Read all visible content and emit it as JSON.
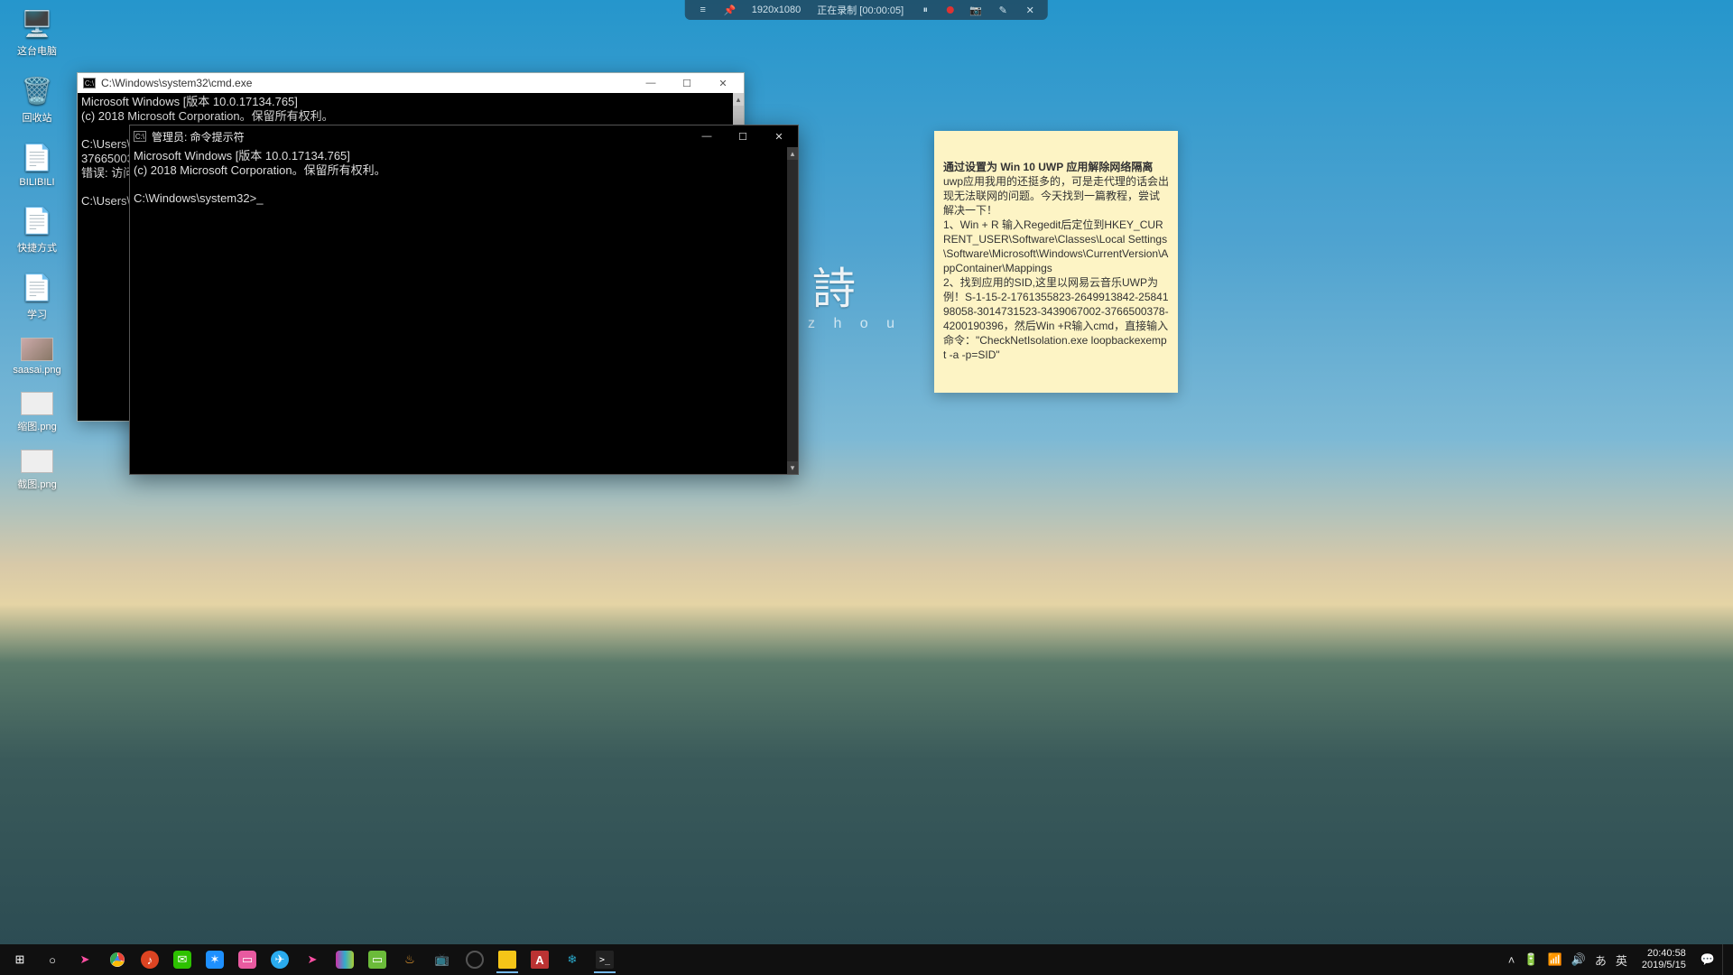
{
  "rec_bar": {
    "resolution": "1920x1080",
    "status": "正在录制 [00:00:05]"
  },
  "desktop_icons": [
    {
      "label": "这台电脑",
      "glyph": "🖥️"
    },
    {
      "label": "回收站",
      "glyph": "🗑️"
    },
    {
      "label": "BILIBILI",
      "glyph": "📄"
    },
    {
      "label": "快捷方式",
      "glyph": "📄"
    },
    {
      "label": "学习",
      "glyph": "📄"
    },
    {
      "label": "saasai.png",
      "glyph": "photo"
    },
    {
      "label": "缩图.png",
      "glyph": "thumb"
    },
    {
      "label": "截图.png",
      "glyph": "thumb"
    }
  ],
  "cmd_back": {
    "title": "C:\\Windows\\system32\\cmd.exe",
    "lines": [
      "Microsoft Windows [版本 10.0.17134.765]",
      "(c) 2018 Microsoft Corporation。保留所有权利。",
      "",
      "C:\\Users\\Z",
      "3766500378",
      "错误: 访问",
      "",
      "C:\\Users\\Z"
    ]
  },
  "cmd_admin": {
    "title": "管理员: 命令提示符",
    "lines": [
      "Microsoft Windows [版本 10.0.17134.765]",
      "(c) 2018 Microsoft Corporation。保留所有权利。",
      "",
      "C:\\Windows\\system32>"
    ]
  },
  "note": {
    "title": "通过设置为 Win 10 UWP 应用解除网络隔离",
    "body": "uwp应用我用的还挺多的，可是走代理的话会出现无法联网的问题。今天找到一篇教程，尝试解决一下！\n1、Win + R 输入Regedit后定位到HKEY_CURRENT_USER\\Software\\Classes\\Local Settings\\Software\\Microsoft\\Windows\\CurrentVersion\\AppContainer\\Mappings\n2、找到应用的SID,这里以网易云音乐UWP为例！S-1-15-2-1761355823-2649913842-2584198058-3014731523-3439067002-3766500378-4200190396，然后Win +R输入cmd，直接输入命令：\"CheckNetIsolation.exe loopbackexempt -a -p=SID\""
  },
  "poem": {
    "main": "詩",
    "sub": "z h o u"
  },
  "taskbar": {
    "items": [
      {
        "name": "start",
        "color": "#000",
        "glyph": "⊞"
      },
      {
        "name": "cortana",
        "color": "#000",
        "glyph": "○"
      },
      {
        "name": "cursor-app",
        "color": "#ff4fa3",
        "glyph": "➤"
      },
      {
        "name": "chrome",
        "color": "#fff",
        "glyph": "◉"
      },
      {
        "name": "netease-music",
        "color": "#d42",
        "glyph": "♪"
      },
      {
        "name": "wechat",
        "color": "#2dc100",
        "glyph": "✉"
      },
      {
        "name": "spark",
        "color": "#1e90ff",
        "glyph": "✶"
      },
      {
        "name": "app-pink",
        "color": "#e85aa0",
        "glyph": "▭"
      },
      {
        "name": "telegram",
        "color": "#2aa",
        "glyph": "✈"
      },
      {
        "name": "cursor-app-2",
        "color": "#ff4fa3",
        "glyph": "➤"
      },
      {
        "name": "app-stripes",
        "color": "#8833aa",
        "glyph": "≡"
      },
      {
        "name": "file-explorer",
        "color": "#6bbb3a",
        "glyph": "▭"
      },
      {
        "name": "app-flame",
        "color": "#f0a030",
        "glyph": "♨"
      },
      {
        "name": "app-tv",
        "color": "#222",
        "glyph": "📺"
      },
      {
        "name": "obs",
        "color": "#111",
        "glyph": "●"
      },
      {
        "name": "sticky-notes",
        "color": "#f5c518",
        "glyph": "▭",
        "active": true
      },
      {
        "name": "autodesk",
        "color": "#b33",
        "glyph": "A"
      },
      {
        "name": "app-teal",
        "color": "#2aa8c9",
        "glyph": "❄"
      },
      {
        "name": "terminal",
        "color": "#222",
        "glyph": ">_",
        "active": true
      }
    ]
  },
  "tray": {
    "chevron": "˄",
    "battery": "🔋",
    "wifi": "📶",
    "volume": "🔊",
    "ime_mode": "あ",
    "ime_lang": "英",
    "time": "20:40:58",
    "date": "2019/5/15",
    "notification": "💬"
  }
}
